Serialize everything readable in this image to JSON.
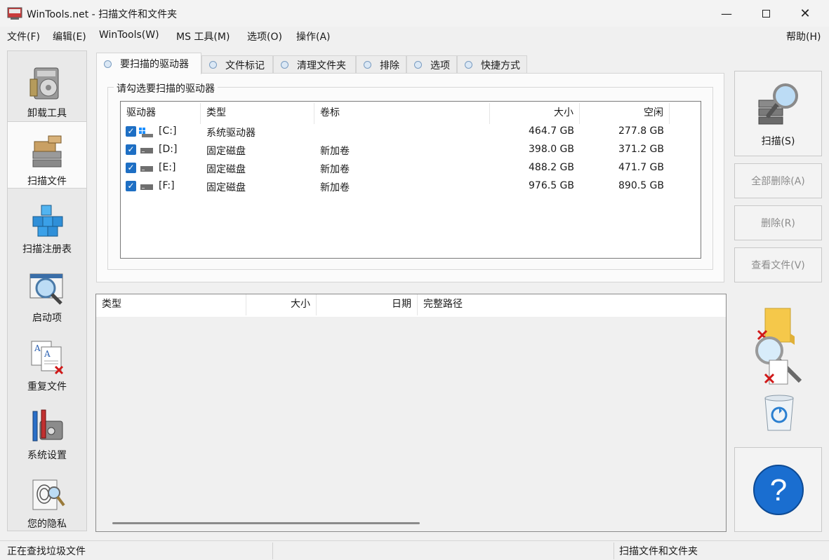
{
  "window": {
    "title": "WinTools.net - 扫描文件和文件夹"
  },
  "menu": {
    "file": "文件(F)",
    "edit": "编辑(E)",
    "wintools": "WinTools(W)",
    "ms_tools": "MS 工具(M)",
    "options": "选项(O)",
    "actions": "操作(A)",
    "help": "帮助(H)"
  },
  "sidebar": {
    "items": [
      {
        "label": "卸载工具",
        "icon": "uninstall-icon"
      },
      {
        "label": "扫描文件",
        "icon": "scan-files-icon",
        "active": true
      },
      {
        "label": "扫描注册表",
        "icon": "registry-icon"
      },
      {
        "label": "启动项",
        "icon": "startup-icon"
      },
      {
        "label": "重复文件",
        "icon": "duplicate-files-icon"
      },
      {
        "label": "系统设置",
        "icon": "system-settings-icon"
      },
      {
        "label": "您的隐私",
        "icon": "privacy-icon"
      }
    ]
  },
  "tabs": [
    {
      "label": "要扫描的驱动器",
      "active": true
    },
    {
      "label": "文件标记"
    },
    {
      "label": "清理文件夹"
    },
    {
      "label": "排除"
    },
    {
      "label": "选项"
    },
    {
      "label": "快捷方式"
    }
  ],
  "drives_group": {
    "title": "请勾选要扫描的驱动器",
    "columns": {
      "drive": "驱动器",
      "type": "类型",
      "label": "卷标",
      "size": "大小",
      "free": "空闲"
    },
    "rows": [
      {
        "checked": true,
        "drive": "[C:]",
        "type": "系统驱动器",
        "label": "",
        "size": "464.7 GB",
        "free": "277.8 GB",
        "icon": "system-drive-icon"
      },
      {
        "checked": true,
        "drive": "[D:]",
        "type": "固定磁盘",
        "label": "新加卷",
        "size": "398.0 GB",
        "free": "371.2 GB",
        "icon": "disk-icon"
      },
      {
        "checked": true,
        "drive": "[E:]",
        "type": "固定磁盘",
        "label": "新加卷",
        "size": "488.2 GB",
        "free": "471.7 GB",
        "icon": "disk-icon"
      },
      {
        "checked": true,
        "drive": "[F:]",
        "type": "固定磁盘",
        "label": "新加卷",
        "size": "976.5 GB",
        "free": "890.5 GB",
        "icon": "disk-icon"
      }
    ]
  },
  "results": {
    "columns": {
      "type": "类型",
      "size": "大小",
      "date": "日期",
      "path": "完整路径"
    }
  },
  "actions": {
    "scan": "扫描(S)",
    "delete_all": "全部删除(A)",
    "delete": "删除(R)",
    "view_file": "查看文件(V)"
  },
  "status": {
    "left": "正在查找垃圾文件",
    "right": "扫描文件和文件夹"
  }
}
